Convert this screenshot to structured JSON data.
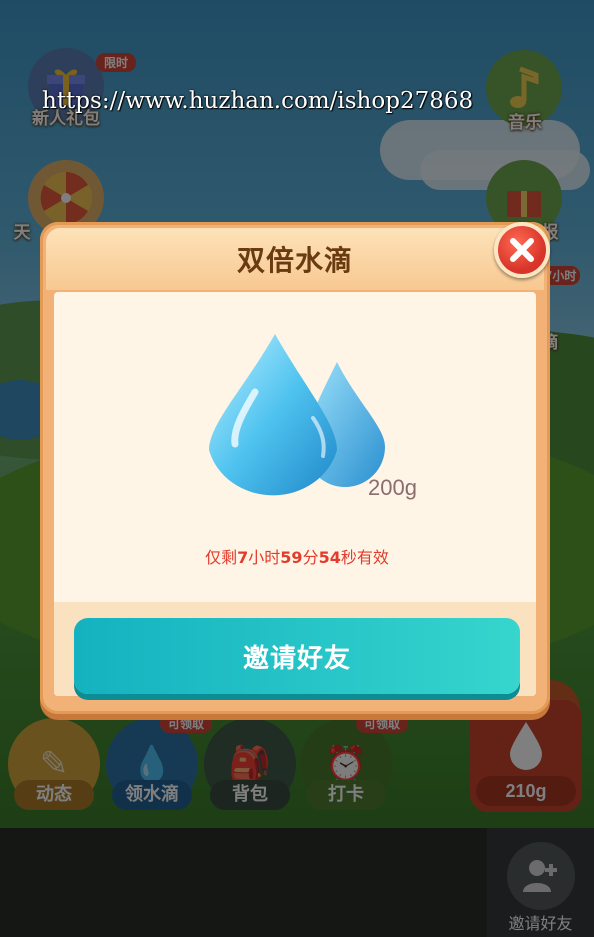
{
  "watermark": "https://www.huzhan.com/ishop27868",
  "top_left": {
    "gift_label": "新人礼包",
    "gift_tag": "限时",
    "wheel_label": "天"
  },
  "top_right": {
    "music_label": "音乐",
    "report_label": "报",
    "drip_label": "滴",
    "drip_tag": "7小时"
  },
  "modal": {
    "title": "双倍水滴",
    "amount": "200g",
    "validity_prefix": "仅剩",
    "validity_hours": "7",
    "validity_hour_unit": "小时",
    "validity_minutes": "59",
    "validity_minute_unit": "分",
    "validity_seconds": "54",
    "validity_suffix": "秒有效",
    "invite_button": "邀请好友"
  },
  "bottom_bar": {
    "items": [
      {
        "label": "动态",
        "tag": ""
      },
      {
        "label": "领水滴",
        "tag": "可领取"
      },
      {
        "label": "背包",
        "tag": ""
      },
      {
        "label": "打卡",
        "tag": "可领取"
      }
    ],
    "kettle_amount": "210g"
  },
  "footer": {
    "invite_label": "邀请好友"
  },
  "colors": {
    "invite_button": "#14b2c0",
    "validity_text": "#e33b2c",
    "close_button": "#d8342a",
    "title_text": "#6a3b10"
  }
}
